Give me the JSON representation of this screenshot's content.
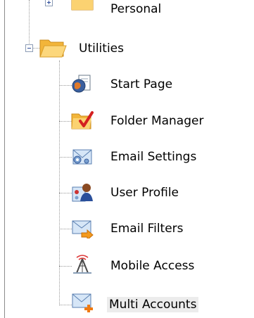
{
  "tree": {
    "personal": {
      "label": "Personal",
      "expanded": false
    },
    "utilities": {
      "label": "Utilities",
      "expanded": true,
      "items": [
        {
          "label": "Start Page",
          "icon": "globe-page-icon"
        },
        {
          "label": "Folder Manager",
          "icon": "folder-check-icon"
        },
        {
          "label": "Email Settings",
          "icon": "email-settings-icon"
        },
        {
          "label": "User Profile",
          "icon": "user-profile-icon"
        },
        {
          "label": "Email Filters",
          "icon": "email-filter-icon"
        },
        {
          "label": "Mobile Access",
          "icon": "antenna-icon"
        },
        {
          "label": "Multi Accounts",
          "icon": "envelope-plus-icon",
          "selected": true
        }
      ]
    }
  },
  "colors": {
    "folder": "#f7c04a",
    "selection": "#ececec",
    "connector": "#9a9a9a",
    "toggle_border": "#8c9cb5"
  }
}
